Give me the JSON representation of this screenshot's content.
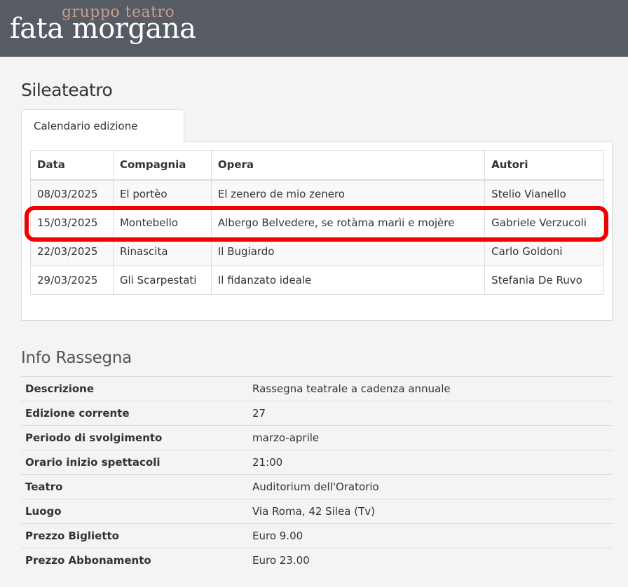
{
  "logo": {
    "top": "gruppo teatro",
    "main": "fata morgana"
  },
  "page_title": "Sileateatro",
  "tab_label": "Calendario edizione",
  "calendar": {
    "headers": [
      "Data",
      "Compagnia",
      "Opera",
      "Autori"
    ],
    "rows": [
      [
        "08/03/2025",
        "El portèo",
        "El zenero de mio zenero",
        "Stelio Vianello"
      ],
      [
        "15/03/2025",
        "Montebello",
        "Albergo Belvedere, se rotàma marìi e mojère",
        "Gabriele Verzucoli"
      ],
      [
        "22/03/2025",
        "Rinascita",
        "Il Bugiardo",
        "Carlo Goldoni"
      ],
      [
        "29/03/2025",
        "Gli Scarpestati",
        "Il fidanzato ideale",
        "Stefania De Ruvo"
      ]
    ],
    "highlighted_row": 1
  },
  "info_title": "Info Rassegna",
  "info": [
    {
      "label": "Descrizione",
      "value": "Rassegna teatrale a cadenza annuale"
    },
    {
      "label": "Edizione corrente",
      "value": "27"
    },
    {
      "label": "Periodo di svolgimento",
      "value": "marzo-aprile"
    },
    {
      "label": "Orario inizio spettacoli",
      "value": "21:00"
    },
    {
      "label": "Teatro",
      "value": "Auditorium dell'Oratorio"
    },
    {
      "label": "Luogo",
      "value": "Via Roma, 42 Silea (Tv)"
    },
    {
      "label": "Prezzo Biglietto",
      "value": "Euro 9.00"
    },
    {
      "label": "Prezzo Abbonamento",
      "value": "Euro 23.00"
    }
  ],
  "colors": {
    "header_bg": "#575b63",
    "logo_accent": "#c79b90",
    "highlight": "#ee0000"
  }
}
